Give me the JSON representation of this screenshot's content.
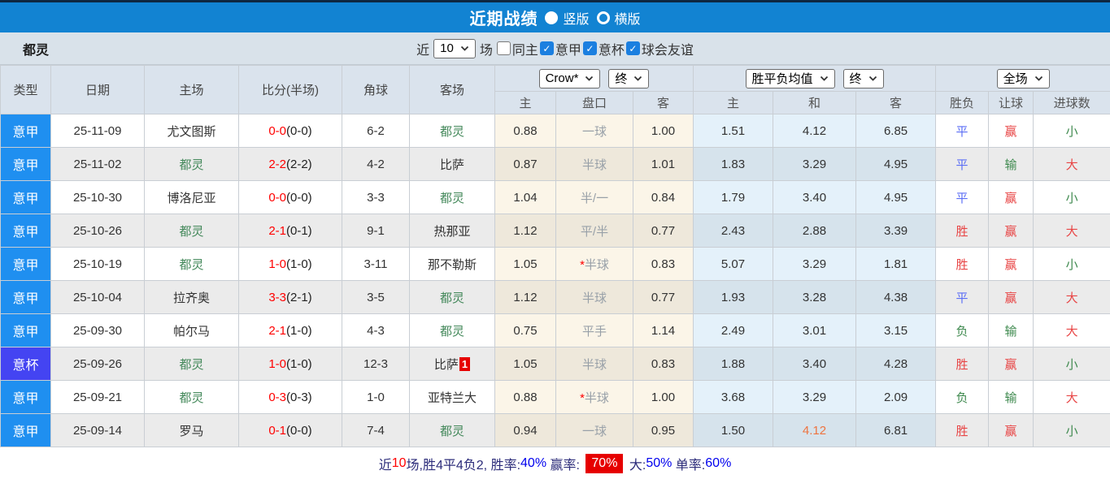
{
  "title_bar": {
    "title": "近期战绩",
    "layout_options": [
      {
        "label": "竖版",
        "selected": true
      },
      {
        "label": "横版",
        "selected": false
      }
    ]
  },
  "filter_bar": {
    "team": "都灵",
    "near_label": "近",
    "games_count": "10",
    "games_suffix": "场",
    "checkboxes": [
      {
        "label": "同主",
        "checked": false
      },
      {
        "label": "意甲",
        "checked": true
      },
      {
        "label": "意杯",
        "checked": true
      },
      {
        "label": "球会友谊",
        "checked": true
      }
    ]
  },
  "table": {
    "main_headers": [
      "类型",
      "日期",
      "主场",
      "比分(半场)",
      "角球",
      "客场"
    ],
    "sub_headers": [
      "主",
      "盘口",
      "客",
      "主",
      "和",
      "客",
      "胜负",
      "让球",
      "进球数"
    ],
    "selects": {
      "company": "Crow*",
      "company_state": "终",
      "europe": "胜平负均值",
      "europe_state": "终",
      "scope": "全场"
    },
    "rows": [
      {
        "type": "意甲",
        "date": "25-11-09",
        "home": "尤文图斯",
        "home_target": false,
        "score": "0-0",
        "half": "(0-0)",
        "corner": "6-2",
        "away": "都灵",
        "away_target": true,
        "away_badge": "",
        "ah_home": "0.88",
        "ah_star": false,
        "ah_line": "一球",
        "ah_away": "1.00",
        "eu_home": "1.51",
        "eu_draw": "4.12",
        "eu_draw_hl": false,
        "eu_away": "6.85",
        "result": "平",
        "handicap": "赢",
        "goals": "小"
      },
      {
        "type": "意甲",
        "date": "25-11-02",
        "home": "都灵",
        "home_target": true,
        "score": "2-2",
        "half": "(2-2)",
        "corner": "4-2",
        "away": "比萨",
        "away_target": false,
        "away_badge": "",
        "ah_home": "0.87",
        "ah_star": false,
        "ah_line": "半球",
        "ah_away": "1.01",
        "eu_home": "1.83",
        "eu_draw": "3.29",
        "eu_draw_hl": false,
        "eu_away": "4.95",
        "result": "平",
        "handicap": "输",
        "goals": "大"
      },
      {
        "type": "意甲",
        "date": "25-10-30",
        "home": "博洛尼亚",
        "home_target": false,
        "score": "0-0",
        "half": "(0-0)",
        "corner": "3-3",
        "away": "都灵",
        "away_target": true,
        "away_badge": "",
        "ah_home": "1.04",
        "ah_star": false,
        "ah_line": "半/一",
        "ah_away": "0.84",
        "eu_home": "1.79",
        "eu_draw": "3.40",
        "eu_draw_hl": false,
        "eu_away": "4.95",
        "result": "平",
        "handicap": "赢",
        "goals": "小"
      },
      {
        "type": "意甲",
        "date": "25-10-26",
        "home": "都灵",
        "home_target": true,
        "score": "2-1",
        "half": "(0-1)",
        "corner": "9-1",
        "away": "热那亚",
        "away_target": false,
        "away_badge": "",
        "ah_home": "1.12",
        "ah_star": false,
        "ah_line": "平/半",
        "ah_away": "0.77",
        "eu_home": "2.43",
        "eu_draw": "2.88",
        "eu_draw_hl": false,
        "eu_away": "3.39",
        "result": "胜",
        "handicap": "赢",
        "goals": "大"
      },
      {
        "type": "意甲",
        "date": "25-10-19",
        "home": "都灵",
        "home_target": true,
        "score": "1-0",
        "half": "(1-0)",
        "corner": "3-11",
        "away": "那不勒斯",
        "away_target": false,
        "away_badge": "",
        "ah_home": "1.05",
        "ah_star": true,
        "ah_line": "半球",
        "ah_away": "0.83",
        "eu_home": "5.07",
        "eu_draw": "3.29",
        "eu_draw_hl": false,
        "eu_away": "1.81",
        "result": "胜",
        "handicap": "赢",
        "goals": "小"
      },
      {
        "type": "意甲",
        "date": "25-10-04",
        "home": "拉齐奥",
        "home_target": false,
        "score": "3-3",
        "half": "(2-1)",
        "corner": "3-5",
        "away": "都灵",
        "away_target": true,
        "away_badge": "",
        "ah_home": "1.12",
        "ah_star": false,
        "ah_line": "半球",
        "ah_away": "0.77",
        "eu_home": "1.93",
        "eu_draw": "3.28",
        "eu_draw_hl": false,
        "eu_away": "4.38",
        "result": "平",
        "handicap": "赢",
        "goals": "大"
      },
      {
        "type": "意甲",
        "date": "25-09-30",
        "home": "帕尔马",
        "home_target": false,
        "score": "2-1",
        "half": "(1-0)",
        "corner": "4-3",
        "away": "都灵",
        "away_target": true,
        "away_badge": "",
        "ah_home": "0.75",
        "ah_star": false,
        "ah_line": "平手",
        "ah_away": "1.14",
        "eu_home": "2.49",
        "eu_draw": "3.01",
        "eu_draw_hl": false,
        "eu_away": "3.15",
        "result": "负",
        "handicap": "输",
        "goals": "大"
      },
      {
        "type": "意杯",
        "date": "25-09-26",
        "home": "都灵",
        "home_target": true,
        "score": "1-0",
        "half": "(1-0)",
        "corner": "12-3",
        "away": "比萨",
        "away_target": false,
        "away_badge": "1",
        "ah_home": "1.05",
        "ah_star": false,
        "ah_line": "半球",
        "ah_away": "0.83",
        "eu_home": "1.88",
        "eu_draw": "3.40",
        "eu_draw_hl": false,
        "eu_away": "4.28",
        "result": "胜",
        "handicap": "赢",
        "goals": "小"
      },
      {
        "type": "意甲",
        "date": "25-09-21",
        "home": "都灵",
        "home_target": true,
        "score": "0-3",
        "half": "(0-3)",
        "corner": "1-0",
        "away": "亚特兰大",
        "away_target": false,
        "away_badge": "",
        "ah_home": "0.88",
        "ah_star": true,
        "ah_line": "半球",
        "ah_away": "1.00",
        "eu_home": "3.68",
        "eu_draw": "3.29",
        "eu_draw_hl": false,
        "eu_away": "2.09",
        "result": "负",
        "handicap": "输",
        "goals": "大"
      },
      {
        "type": "意甲",
        "date": "25-09-14",
        "home": "罗马",
        "home_target": false,
        "score": "0-1",
        "half": "(0-0)",
        "corner": "7-4",
        "away": "都灵",
        "away_target": true,
        "away_badge": "",
        "ah_home": "0.94",
        "ah_star": false,
        "ah_line": "一球",
        "ah_away": "0.95",
        "eu_home": "1.50",
        "eu_draw": "4.12",
        "eu_draw_hl": true,
        "eu_away": "6.81",
        "result": "胜",
        "handicap": "赢",
        "goals": "小"
      }
    ]
  },
  "footer": {
    "segments": [
      {
        "text": "近",
        "style": "label"
      },
      {
        "text": "10",
        "style": "red"
      },
      {
        "text": "场,胜4平4负2, ",
        "style": "label"
      },
      {
        "text": "胜率:",
        "style": "label"
      },
      {
        "text": "40%",
        "style": "blue"
      },
      {
        "text": " 赢率: ",
        "style": "label"
      },
      {
        "text": "70%",
        "style": "badge"
      },
      {
        "text": " 大:",
        "style": "label"
      },
      {
        "text": "50%",
        "style": "blue"
      },
      {
        "text": " 单率:",
        "style": "label"
      },
      {
        "text": "60%",
        "style": "blue"
      }
    ]
  },
  "colors": {
    "topbar_blue": "#1283d2",
    "league_type_blue": "#1f8ff0",
    "cup_type_violet": "#4444f2",
    "target_team_green": "#43885a",
    "score_red": "#ff0000",
    "win_red": "#e84545",
    "draw_blue": "#5b6ef5",
    "lose_green": "#3f8a4f",
    "draw_odds_highlight_orange": "#ee7440",
    "footer_pct_blue": "#0000ee",
    "footer_badge_red": "#e60000"
  }
}
